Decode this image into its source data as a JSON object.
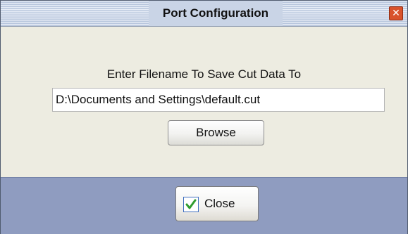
{
  "dialog": {
    "title": "Port Configuration",
    "close_glyph": "✕",
    "prompt": "Enter Filename To Save Cut Data To",
    "filename_value": "D:\\Documents and Settings\\default.cut",
    "browse_label": "Browse",
    "close_label": "Close"
  },
  "icons": {
    "title_close": "close-icon",
    "close_button": "checkmark-icon"
  },
  "colors": {
    "content_bg": "#edece1",
    "footer_bg": "#8f9cc0",
    "title_close_bg": "#d9532c",
    "checkmark": "#2f9c2f"
  }
}
